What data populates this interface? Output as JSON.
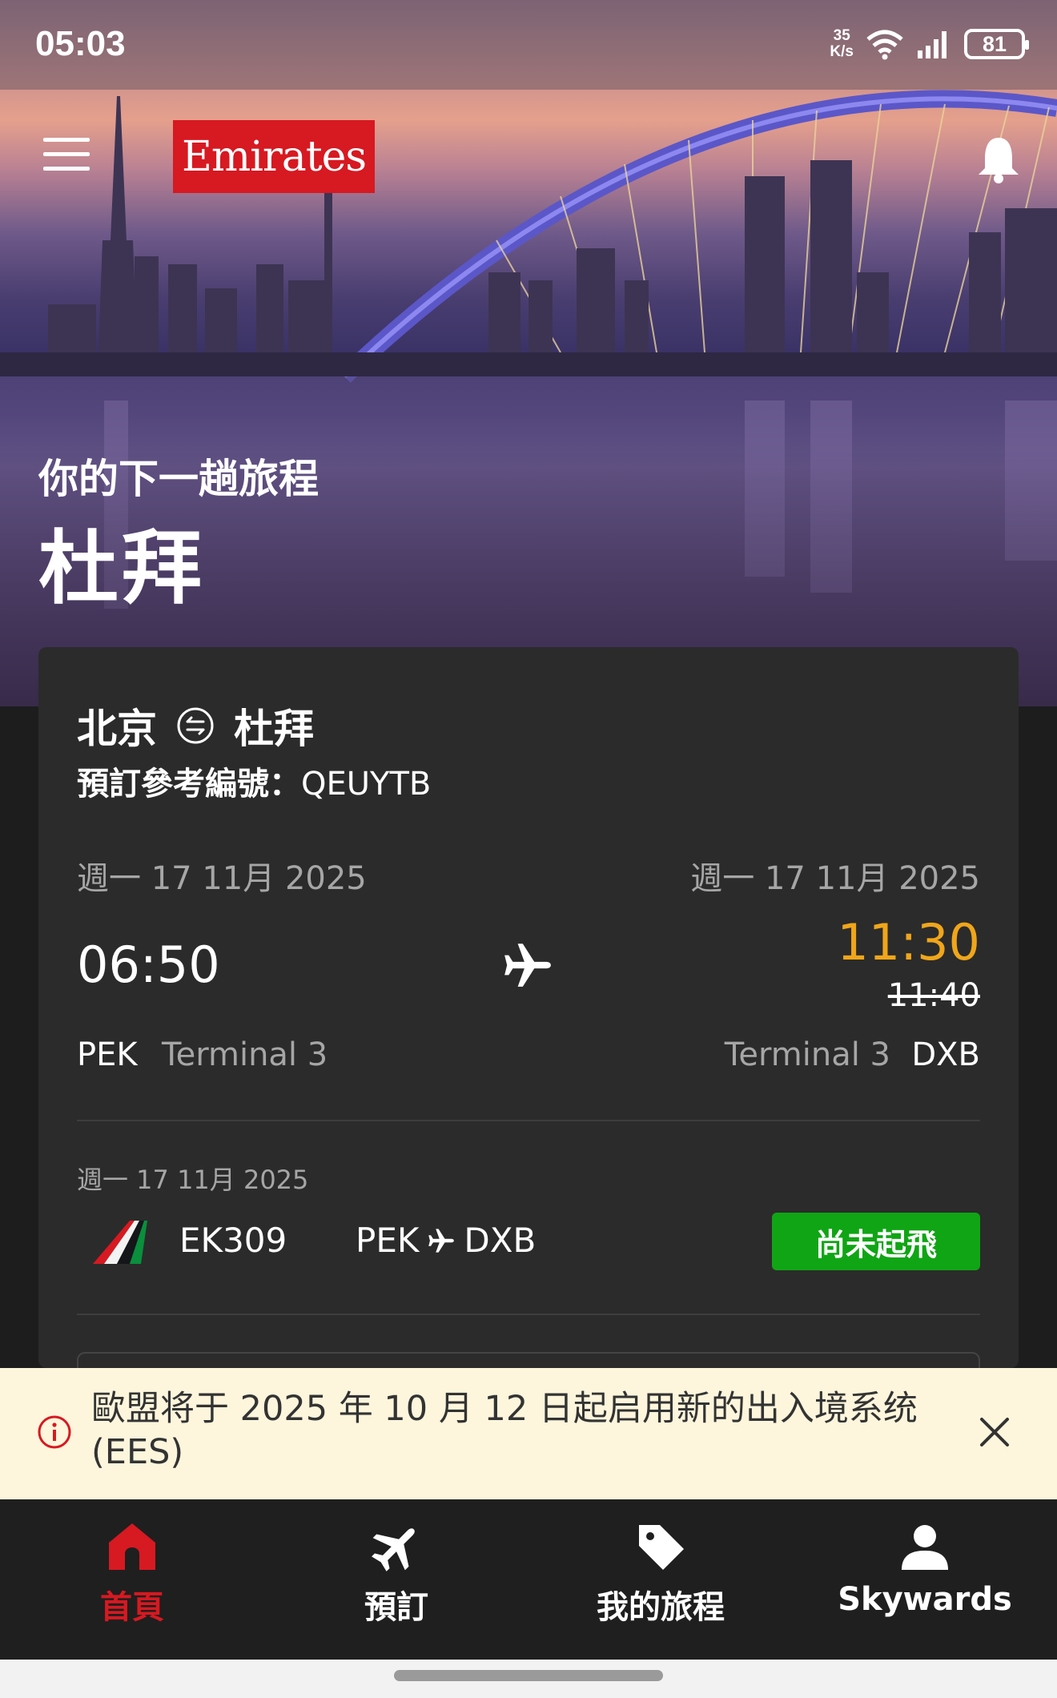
{
  "status_bar": {
    "time": "05:03",
    "net_speed_value": "35",
    "net_speed_unit": "K/s",
    "battery": "81"
  },
  "header": {
    "brand": "Emirates",
    "brand_color": "#d71921"
  },
  "hero": {
    "label": "你的下一趟旅程",
    "destination": "杜拜"
  },
  "trip": {
    "origin": "北京",
    "destination": "杜拜",
    "booking_ref_label": "預訂參考編號：",
    "booking_ref": "QEUYTB",
    "departure_date": "週一 17 11月 2025",
    "arrival_date": "週一 17 11月 2025",
    "departure_time": "06:50",
    "arrival_time": "11:30",
    "arrival_time_original": "11:40",
    "arrival_time_color": "#f0a61a",
    "departure_airport": "PEK",
    "departure_terminal": "Terminal 3",
    "arrival_terminal": "Terminal 3",
    "arrival_airport": "DXB"
  },
  "segment": {
    "date": "週一 17 11月 2025",
    "flight_number": "EK309",
    "from": "PEK",
    "to": "DXB",
    "status": "尚未起飛",
    "status_color": "#10a515"
  },
  "banner": {
    "text": "歐盟将于 2025 年 10 月 12 日起启用新的出入境系统 (EES)"
  },
  "bottom_nav": {
    "items": [
      {
        "label": "首頁",
        "icon": "home-icon",
        "active": true
      },
      {
        "label": "預訂",
        "icon": "plane-icon",
        "active": false
      },
      {
        "label": "我的旅程",
        "icon": "tag-icon",
        "active": false
      },
      {
        "label": "Skywards",
        "icon": "person-icon",
        "active": false
      }
    ]
  }
}
